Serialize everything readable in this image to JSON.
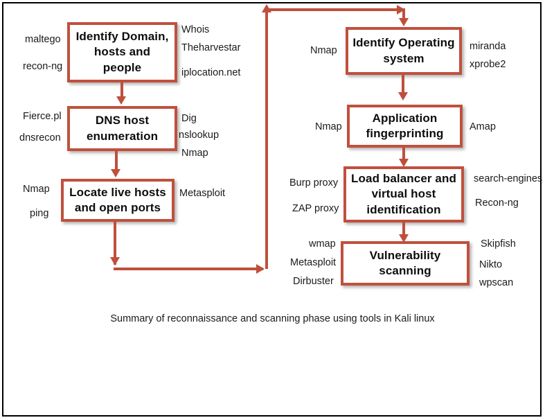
{
  "diagram": {
    "title": "Summary of reconnaissance and scanning phase using tools in Kali linux",
    "accent_color": "#c0503d",
    "frame_color": "#000000",
    "background_color": "#ffffff",
    "text_color": "#0d0d0d"
  },
  "boxes": [
    {
      "id": "identify-domain",
      "label": "Identify Domain, hosts and people"
    },
    {
      "id": "dns-enumeration",
      "label": "DNS host enumeration"
    },
    {
      "id": "locate-live-hosts",
      "label": "Locate live hosts and open ports"
    },
    {
      "id": "identify-os",
      "label": "Identify Operating system"
    },
    {
      "id": "application-fingerprint",
      "label": "Application fingerprinting"
    },
    {
      "id": "load-balancer",
      "label": "Load balancer and virtual host identification"
    },
    {
      "id": "vulnerability-scanning",
      "label": "Vulnerability scanning"
    }
  ],
  "tools": {
    "identify_domain": {
      "left": [
        "maltego",
        "recon-ng"
      ],
      "right": [
        "Whois",
        "Theharvestar",
        "iplocation.net"
      ]
    },
    "dns_enumeration": {
      "left": [
        "Fierce.pl",
        "dnsrecon"
      ],
      "right": [
        "Dig",
        "nslookup",
        "Nmap"
      ]
    },
    "locate_live_hosts": {
      "left": [
        "Nmap",
        "ping"
      ],
      "right": [
        "Metasploit"
      ]
    },
    "identify_os": {
      "left": [
        "Nmap"
      ],
      "right": [
        "miranda",
        "xprobe2"
      ]
    },
    "application_fingerprinting": {
      "left": [
        "Nmap"
      ],
      "right": [
        "Amap"
      ]
    },
    "load_balancer": {
      "left": [
        "Burp proxy",
        "ZAP proxy"
      ],
      "right": [
        "search-engines",
        "Recon-ng"
      ]
    },
    "vulnerability_scanning": {
      "left": [
        "wmap",
        "Metasploit",
        "Dirbuster"
      ],
      "right": [
        "Skipfish",
        "Nikto",
        "wpscan"
      ]
    }
  },
  "flow": [
    {
      "from": "identify-domain",
      "to": "dns-enumeration"
    },
    {
      "from": "dns-enumeration",
      "to": "locate-live-hosts"
    },
    {
      "from": "locate-live-hosts",
      "to": "identify-os"
    },
    {
      "from": "identify-os",
      "to": "application-fingerprint"
    },
    {
      "from": "application-fingerprint",
      "to": "load-balancer"
    },
    {
      "from": "load-balancer",
      "to": "vulnerability-scanning"
    }
  ]
}
